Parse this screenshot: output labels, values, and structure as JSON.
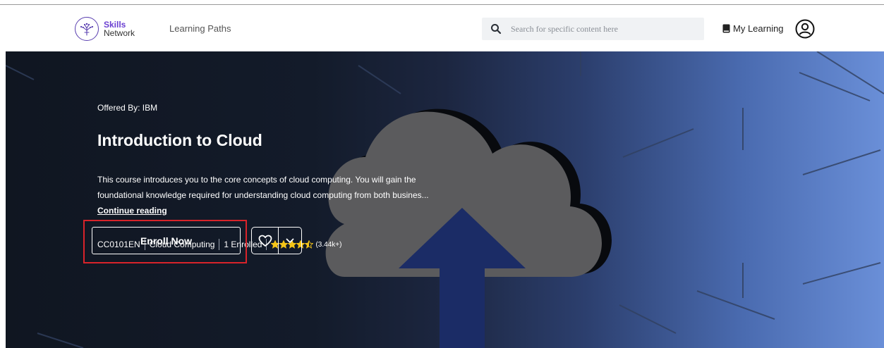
{
  "header": {
    "logo": {
      "line1": "Skills",
      "line2": "Network"
    },
    "nav_link": "Learning Paths",
    "search": {
      "placeholder": "Search for specific content here",
      "value": ""
    },
    "my_learning_label": "My Learning"
  },
  "course": {
    "offered_by": "Offered By: IBM",
    "title": "Introduction to Cloud",
    "description_line1": "This course introduces you to the core concepts of cloud computing. You will gain the",
    "description_line2": "foundational knowledge required for understanding cloud computing from both busines...",
    "continue_reading": "Continue reading",
    "code": "CC0101EN",
    "category": "Cloud Computing",
    "enrolled": "1 Enrolled",
    "rating": 4.5,
    "rating_count": "(3.44k+)",
    "enroll_label": "Enroll Now"
  },
  "icons": {
    "logo": "skills-network-tree-icon",
    "search": "search-icon",
    "book": "book-icon",
    "avatar": "user-avatar-icon",
    "star": "star-icon",
    "heart": "heart-icon",
    "chevron": "chevron-down-icon"
  },
  "colors": {
    "brand_purple": "#6a3fd1",
    "star_gold": "#f5c518",
    "highlight_red": "#d8232a",
    "hero_dark": "#101621",
    "hero_blue": "#6a8fd8"
  }
}
